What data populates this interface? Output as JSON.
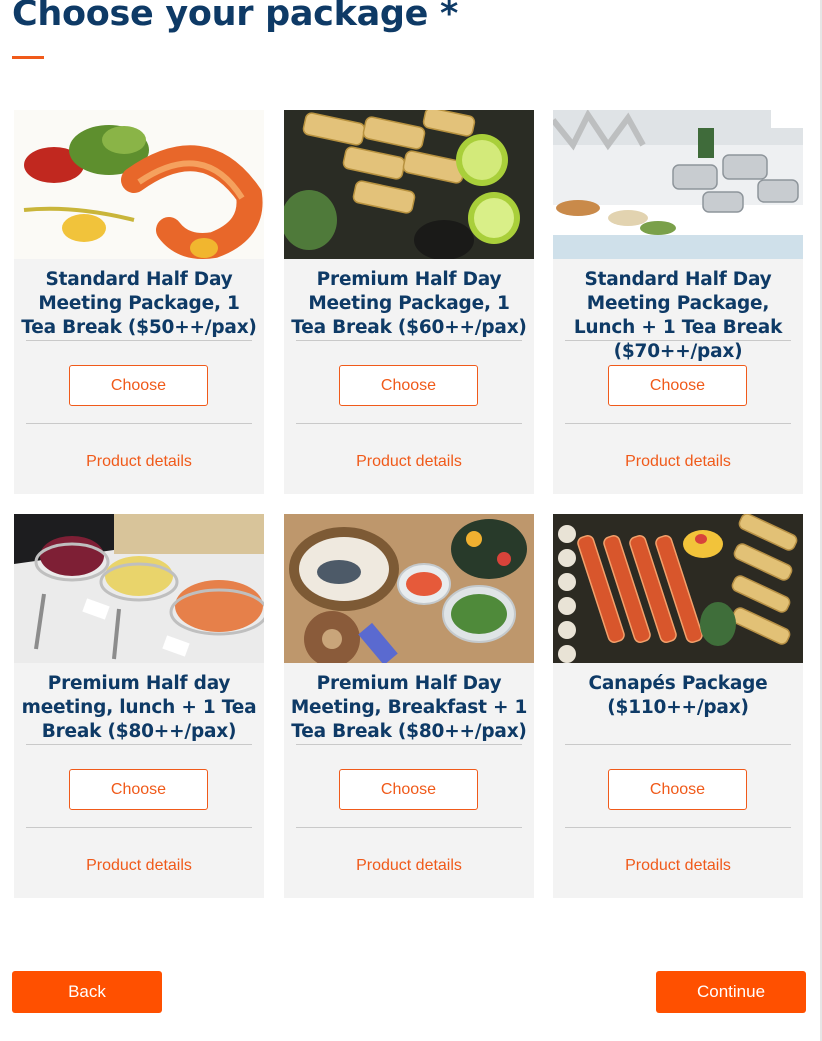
{
  "page": {
    "title": "Choose your package *"
  },
  "colors": {
    "accent": "#f05a1a",
    "button_fill": "#ff5000",
    "title_navy": "#0e3a66",
    "card_bg": "#f3f3f3"
  },
  "packages": [
    {
      "title": "Standard Half Day Meeting Package, 1 Tea Break ($50++/pax)",
      "choose_label": "Choose",
      "details_label": "Product details",
      "image": "shrimp-plate"
    },
    {
      "title": "Premium Half Day Meeting Package, 1 Tea Break ($60++/pax)",
      "choose_label": "Choose",
      "details_label": "Product details",
      "image": "spring-rolls-limes"
    },
    {
      "title": "Standard Half Day Meeting Package, Lunch + 1 Tea Break ($70++/pax)",
      "choose_label": "Choose",
      "details_label": "Product details",
      "image": "buffet-chafing-dishes"
    },
    {
      "title": "Premium Half day meeting, lunch + 1 Tea Break ($80++/pax)",
      "choose_label": "Choose",
      "details_label": "Product details",
      "image": "salad-buffet"
    },
    {
      "title": "Premium Half Day Meeting, Breakfast + 1 Tea Break ($80++/pax)",
      "choose_label": "Choose",
      "details_label": "Product details",
      "image": "breakfast-spread"
    },
    {
      "title": "Canapés Package ($110++/pax)",
      "choose_label": "Choose",
      "details_label": "Product details",
      "image": "canape-platter"
    }
  ],
  "nav": {
    "back_label": "Back",
    "continue_label": "Continue"
  }
}
